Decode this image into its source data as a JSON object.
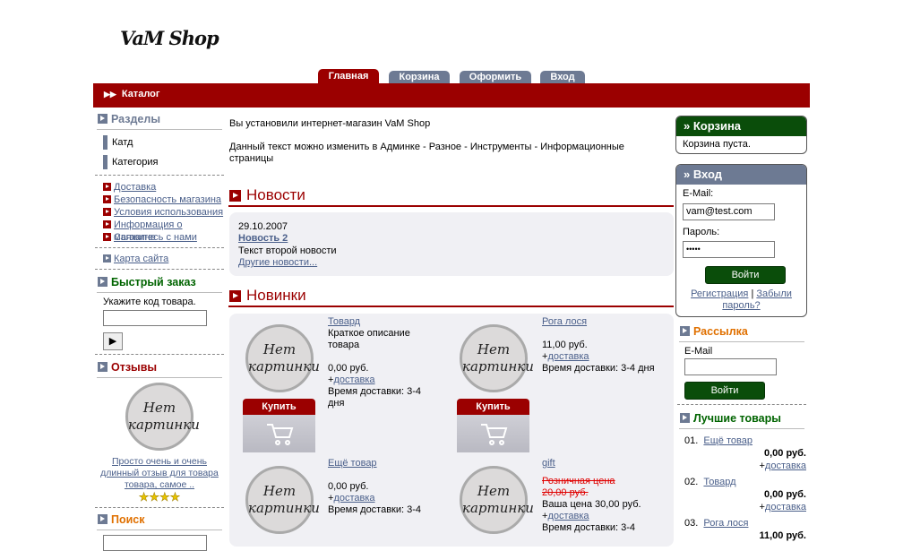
{
  "logo": "VaM Shop",
  "tabs": [
    {
      "label": "Главная",
      "active": true
    },
    {
      "label": "Корзина",
      "active": false
    },
    {
      "label": "Оформить",
      "active": false
    },
    {
      "label": "Вход",
      "active": false
    }
  ],
  "catbar": {
    "label": "Каталог"
  },
  "left": {
    "sections_title": "Разделы",
    "categories": [
      "Катд",
      "Категория"
    ],
    "info_links": [
      "Доставка",
      "Безопасность магазина",
      "Условия использования",
      "Информация о магазине",
      "Свяжитесь с нами"
    ],
    "sitemap": "Карта сайта",
    "quick_title": "Быстрый заказ",
    "quick_label": "Укажите код товара.",
    "quick_go": "▶",
    "reviews_title": "Отзывы",
    "review_text": "Просто очень и очень длинный отзыв для товара товара, самое ..",
    "review_stars": "★★★★",
    "search_title": "Поиск"
  },
  "nopic_text": [
    "Нет",
    "картинки"
  ],
  "center": {
    "intro1": "Вы установили интернет-магазин VaM Shop",
    "intro2": "Данный текст можно изменить в Админке - Разное - Инструменты - Информационные страницы",
    "news_title": "Новости",
    "news_date": "29.10.2007",
    "news_link": "Новость 2",
    "news_text": "Текст второй новости",
    "news_more": "Другие новости...",
    "new_title": "Новинки",
    "buy_label": "Купить",
    "products": [
      {
        "name": "Товард",
        "desc": "Краткое описание товара",
        "price": "0,00 руб.",
        "delivery": "доставка",
        "time": "Время доставки:  3-4 дня"
      },
      {
        "name": "Рога лося",
        "desc": "",
        "price": "11,00 руб.",
        "delivery": "доставка",
        "time": "Время доставки:  3-4 дня"
      },
      {
        "name": "Ещё товар",
        "desc": "",
        "price": "0,00 руб.",
        "delivery": "доставка",
        "time": "Время доставки:  3-4"
      },
      {
        "name": "gift",
        "old_price": "Розничная цена 20,00 руб.",
        "your_price": "Ваша цена 30,00 руб.",
        "delivery": "доставка",
        "time": "Время доставки:  3-4"
      }
    ]
  },
  "right": {
    "cart_title": "» Корзина",
    "cart_empty": "Корзина пуста.",
    "login_title": "» Вход",
    "email_label": "E-Mail:",
    "email_value": "vam@test.com",
    "password_label": "Пароль:",
    "password_value": "•••••",
    "login_btn": "Войти",
    "register": "Регистрация",
    "sep": "|",
    "forgot": "Забыли пароль?",
    "newsletter_title": "Рассылка",
    "newsletter_email": "E-Mail",
    "newsletter_btn": "Войти",
    "best_title": "Лучшие товары",
    "best": [
      {
        "n": "01.",
        "name": "Ещё товар",
        "price": "0,00 руб.",
        "delivery": "доставка"
      },
      {
        "n": "02.",
        "name": "Товард",
        "price": "0,00 руб.",
        "delivery": "доставка"
      },
      {
        "n": "03.",
        "name": "Рога лося",
        "price": "11,00 руб."
      }
    ]
  }
}
